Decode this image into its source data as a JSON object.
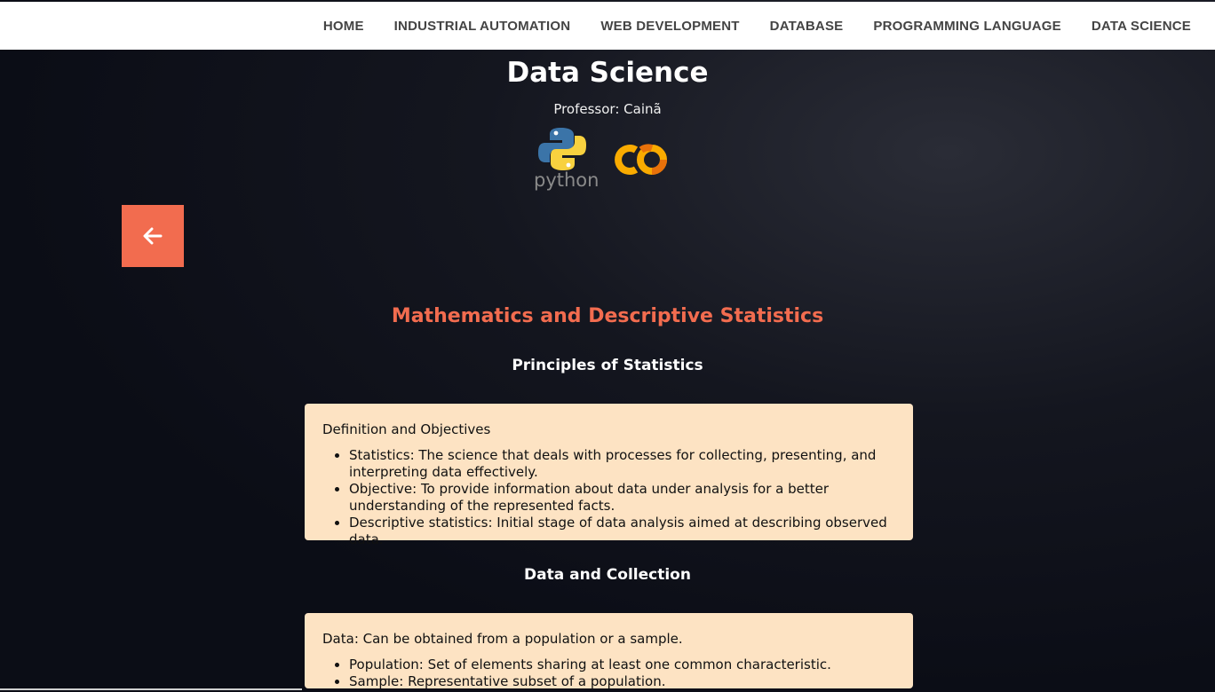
{
  "nav": {
    "items": [
      {
        "label": "HOME"
      },
      {
        "label": "INDUSTRIAL AUTOMATION"
      },
      {
        "label": "WEB DEVELOPMENT"
      },
      {
        "label": "DATABASE"
      },
      {
        "label": "PROGRAMMING LANGUAGE"
      },
      {
        "label": "DATA SCIENCE"
      }
    ]
  },
  "header": {
    "title": "Data Science",
    "professor": "Professor: Cainã",
    "logos": [
      {
        "icon": "python-logo",
        "word": "python"
      },
      {
        "icon": "colab-logo"
      }
    ]
  },
  "back_button": {
    "icon": "arrow-left-icon"
  },
  "main": {
    "section_title": "Mathematics and Descriptive Statistics",
    "sections": [
      {
        "heading": "Principles of Statistics",
        "card_intro": "Definition and Objectives",
        "items": [
          "Statistics: The science that deals with processes for collecting, presenting, and interpreting data effectively.",
          "Objective: To provide information about data under analysis for a better understanding of the represented facts.",
          "Descriptive statistics: Initial stage of data analysis aimed at describing observed data."
        ]
      },
      {
        "heading": "Data and Collection",
        "card_intro": "Data: Can be obtained from a population or a sample.",
        "items": [
          "Population: Set of elements sharing at least one common characteristic.",
          "Sample: Representative subset of a population."
        ]
      }
    ]
  },
  "colors": {
    "accent": "#f26c4f",
    "card_bg": "#fde3c3",
    "navbar_bg": "#ffffff",
    "page_bg": "#0b0d16"
  }
}
